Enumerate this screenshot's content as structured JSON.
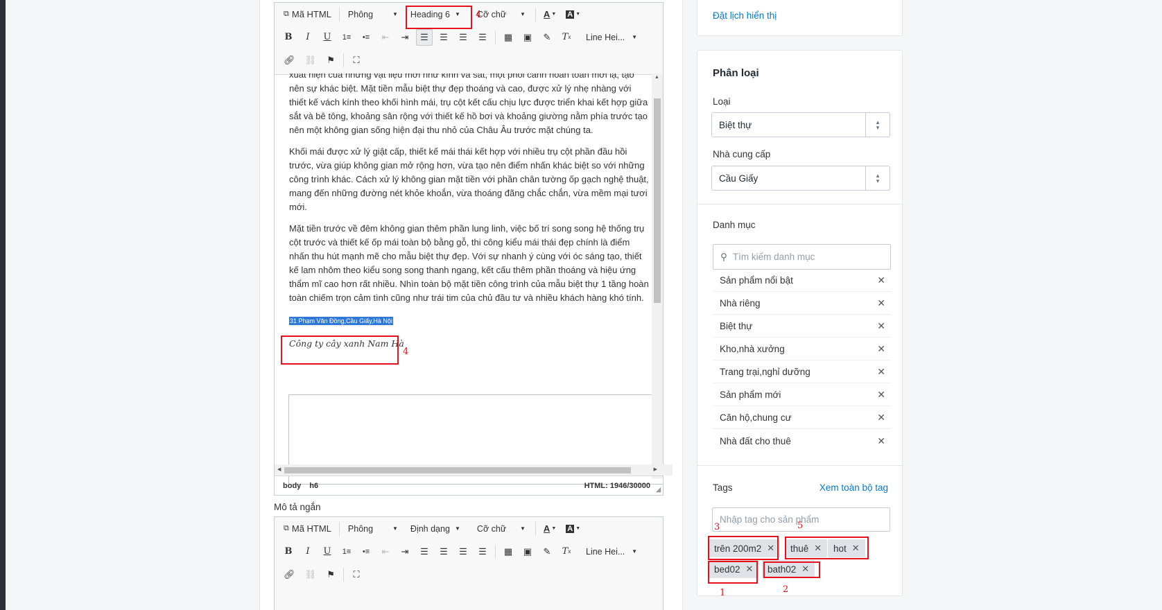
{
  "toolbar": {
    "html_label": "Mã HTML",
    "font_label": "Phông",
    "format_value": "Heading 6",
    "size_label": "Cỡ chữ",
    "line_height_label": "Line Hei..."
  },
  "editor": {
    "paragraphs": [
      "xuất hiện của những vật liệu mới như kính và sắt, một phối cảnh hoàn toàn mới lạ, tạo nên sự khác biệt. Mặt tiền mẫu biệt thự đẹp thoáng và cao, được xử lý nhẹ nhàng với thiết kế vách kính theo khối hình mái, trụ cột kết cấu chịu lực được triển khai kết hợp giữa sắt và bê tông, khoảng sân rộng với thiết kế hồ bơi và khoảng giường nằm phía trước tạo nên một không gian sống hiện đại thu nhỏ của Châu Âu trước mặt chúng ta.",
      "Khối mái được xử lý giật cấp, thiết kế mái thái kết hợp với nhiều trụ cột phần đầu hồi trước, vừa giúp không gian mở rộng hơn, vừa tạo nên điểm nhấn khác biệt so với những công trình khác. Cách xử lý không gian mặt tiền với phần chân tường ốp gạch nghệ thuật, mang đến những đường nét khỏe khoắn, vừa thoáng đãng chắc chắn, vừa mềm mại tươi mới.",
      "Mặt tiền trước về đêm không gian thêm phần lung linh, việc bố trí song song hệ thống trụ cột trước và thiết kế ốp mái toàn bộ bằng gỗ, thi công kiểu mái thái đẹp chính là điểm nhấn thu hút mạnh mẽ cho mẫu biệt thự đẹp. Với sự nhanh ý cùng với óc sáng tạo, thiết kế lam nhôm theo kiểu song song thanh ngang, kết cấu thêm phần thoáng và hiệu ứng thẩm mĩ cao hơn rất nhiều. Nhìn toàn bộ mặt tiền công trình của mẫu biệt thự 1 tầng hoàn toàn chiếm trọn cảm tình cũng như trái tim của chủ đầu tư và nhiều khách hàng khó tính."
    ],
    "selected_h6": "31 Phạm Văn Đồng,Cầu Giấy,Hà Nội",
    "italic_line": "Công ty cây xanh Nam Hà",
    "status_path": [
      "body",
      "h6"
    ],
    "status_count": "HTML: 1946/30000"
  },
  "short_desc": {
    "label": "Mô tả ngắn",
    "format_label": "Định dạng"
  },
  "annotations": {
    "n1": "1",
    "n2": "2",
    "n3": "3",
    "n4a": "4",
    "n4b": "4",
    "n5": "5"
  },
  "display": {
    "schedule_link": "Đặt lịch hiển thị"
  },
  "classify": {
    "title": "Phân loại",
    "type_label": "Loại",
    "type_value": "Biệt thự",
    "vendor_label": "Nhà cung cấp",
    "vendor_value": "Cầu Giấy",
    "category_label": "Danh mục",
    "category_placeholder": "Tìm kiếm danh mục",
    "categories": [
      "Sản phẩm nổi bật",
      "Nhà riêng",
      "Biệt thự",
      "Kho,nhà xưởng",
      "Trang trại,nghỉ dưỡng",
      "Sản phẩm mới",
      "Căn hộ,chung cư",
      "Nhà đất cho thuê"
    ],
    "tags_label": "Tags",
    "tags_link": "Xem toàn bộ tag",
    "tags_placeholder": "Nhập tag cho sản phẩm",
    "tags": [
      "trên 200m2",
      "thuê",
      "hot",
      "bed02",
      "bath02"
    ]
  },
  "colors": {
    "accent": "#007ace",
    "annotation": "#e8101a",
    "selection": "#2f78d8"
  }
}
